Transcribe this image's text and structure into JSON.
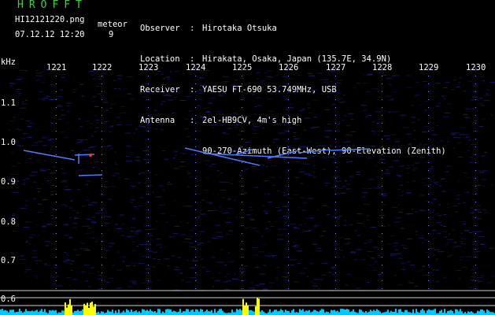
{
  "header": {
    "brand": "HROFFT",
    "filename": "HI12121220.png",
    "meteor_label": "meteor",
    "datetime": "07.12.12 12:20",
    "meteor_count": "9"
  },
  "info": [
    {
      "key": "Observer",
      "value": "Hirotaka Otsuka"
    },
    {
      "key": "Location",
      "value": "Hirakata, Osaka, Japan (135.7E, 34.9N)"
    },
    {
      "key": "Receiver",
      "value": "YAESU FT-690 53.749MHz, USB"
    },
    {
      "key": "Antenna",
      "value": "2el-HB9CV, 4m's high"
    },
    {
      "key": "",
      "value": "90-270-Azimuth (East-West), 90-Elevation (Zenith)"
    }
  ],
  "axis": {
    "y_unit": "kHz",
    "x_ticks": [
      "1221",
      "1222",
      "1223",
      "1224",
      "1225",
      "1226",
      "1227",
      "1228",
      "1229",
      "1230"
    ],
    "y_ticks": [
      "1.1",
      "1.0",
      "0.9",
      "0.8",
      "0.7",
      "0.6"
    ]
  },
  "colors": {
    "background": "#000000",
    "noise": "#1a1a6e",
    "signal": "#4f7cff",
    "grid": "#d0d0d0",
    "level": "#ffff00",
    "level_low": "#00c8ff",
    "brand": "#3fd23f"
  }
}
